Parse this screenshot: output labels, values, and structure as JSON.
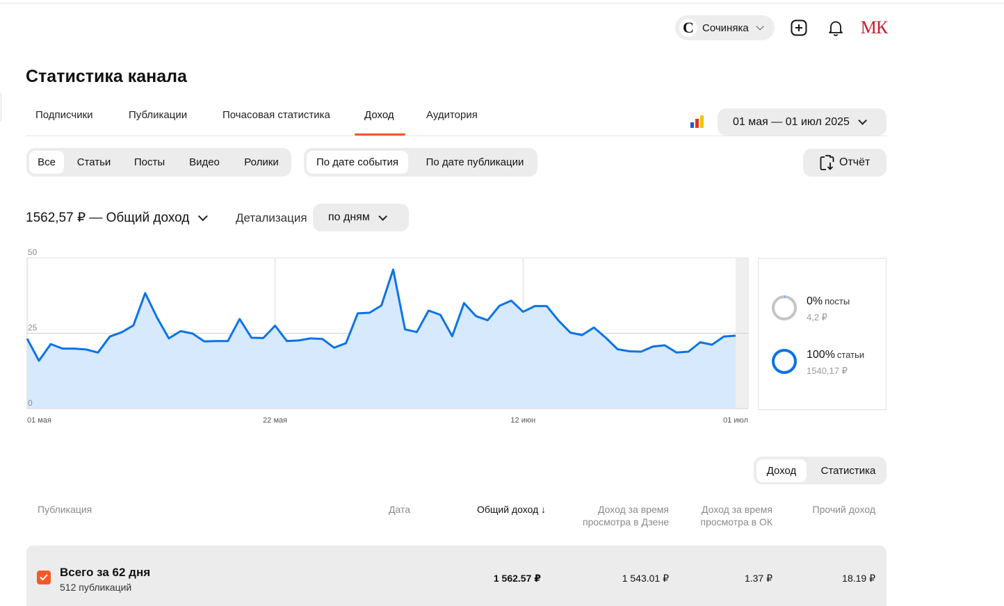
{
  "header": {
    "channel_logo": "С",
    "channel_name": "Сочиняка",
    "avatar": "МК"
  },
  "page_title": "Статистика канала",
  "tabs": [
    {
      "label": "Подписчики",
      "active": false
    },
    {
      "label": "Публикации",
      "active": false
    },
    {
      "label": "Почасовая статистика",
      "active": false
    },
    {
      "label": "Доход",
      "active": true
    },
    {
      "label": "Аудитория",
      "active": false
    }
  ],
  "date_range": "01 мая — 01 июл 2025",
  "content_filter": {
    "items": [
      "Все",
      "Статьи",
      "Посты",
      "Видео",
      "Ролики"
    ],
    "selected": "Все"
  },
  "date_mode": {
    "items": [
      "По дате события",
      "По дате публикации"
    ],
    "selected": "По дате события"
  },
  "report_button": "Отчёт",
  "total_label": "1562,57 ₽ — Общий доход",
  "detail": {
    "label": "Детализация",
    "value": "по дням"
  },
  "chart_data": {
    "type": "area",
    "x_labels": [
      "01 мая",
      "22 мая",
      "12 июн",
      "01 июл"
    ],
    "y_ticks": [
      0,
      25,
      50
    ],
    "ylim": [
      0,
      50
    ],
    "x_start": "01 мая 2025",
    "x_end": "01 июл 2025",
    "series": [
      {
        "values": [
          23.2,
          15.9,
          21.4,
          19.9,
          19.9,
          19.6,
          18.6,
          23.9,
          25.3,
          27.6,
          38.3,
          30.2,
          23.3,
          25.7,
          24.9,
          22.3,
          22.4,
          22.4,
          29.7,
          23.5,
          23.4,
          27.5,
          22.4,
          22.6,
          23.3,
          23.1,
          20.2,
          21.7,
          31.6,
          31.8,
          34.2,
          46.1,
          26.3,
          25.4,
          32.5,
          31.1,
          24.0,
          35.0,
          30.7,
          29.3,
          34.1,
          35.8,
          32.1,
          34.0,
          34.0,
          29.2,
          25.2,
          24.4,
          26.9,
          23.5,
          19.7,
          19.0,
          18.9,
          20.6,
          21.0,
          18.6,
          18.9,
          22.0,
          21.2,
          23.9,
          24.2
        ]
      }
    ],
    "line_color": "#0a73e8",
    "fill_color": "#d6e9fd"
  },
  "breakdown": [
    {
      "pct": "0%",
      "name": "посты",
      "amount": "4,2 ₽",
      "color": "#0a73e8",
      "share": 0.003
    },
    {
      "pct": "100%",
      "name": "статьи",
      "amount": "1540,17 ₽",
      "color": "#0a73e8",
      "share": 1.0
    }
  ],
  "table_toggle": {
    "items": [
      "Доход",
      "Статистика"
    ],
    "selected": "Доход"
  },
  "table": {
    "headers": {
      "publication": "Публикация",
      "date": "Дата",
      "total": "Общий доход",
      "dzen_line1": "Доход за время",
      "dzen_line2": "просмотра в Дзене",
      "ok_line1": "Доход за время",
      "ok_line2": "просмотра в ОК",
      "other": "Прочий доход"
    },
    "summary": {
      "title": "Всего за 62 дня",
      "subtitle": "512 публикаций",
      "total": "1 562.57 ₽",
      "dzen": "1 543.01 ₽",
      "ok": "1.37 ₽",
      "other": "18.19 ₽"
    }
  },
  "colors": {
    "accent": "#f25a29",
    "chart_line": "#0a73e8",
    "pill_bg": "#ececec"
  }
}
